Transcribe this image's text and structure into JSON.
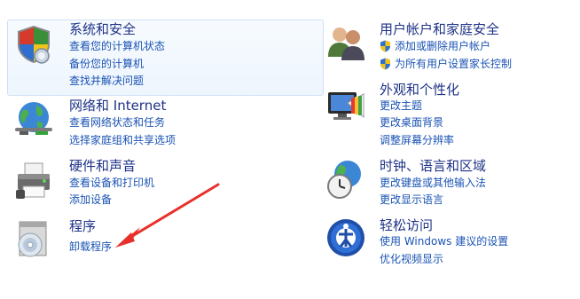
{
  "categories": [
    {
      "title": "系统和安全",
      "links": [
        "查看您的计算机状态",
        "备份您的计算机",
        "查找并解决问题"
      ]
    },
    {
      "title": "网络和 Internet",
      "links": [
        "查看网络状态和任务",
        "选择家庭组和共享选项"
      ]
    },
    {
      "title": "硬件和声音",
      "links": [
        "查看设备和打印机",
        "添加设备"
      ]
    },
    {
      "title": "程序",
      "links": [
        "卸载程序"
      ]
    },
    {
      "title": "用户帐户和家庭安全",
      "links": [
        "添加或删除用户帐户",
        "为所有用户设置家长控制"
      ]
    },
    {
      "title": "外观和个性化",
      "links": [
        "更改主题",
        "更改桌面背景",
        "调整屏幕分辨率"
      ]
    },
    {
      "title": "时钟、语言和区域",
      "links": [
        "更改键盘或其他输入法",
        "更改显示语言"
      ]
    },
    {
      "title": "轻松访问",
      "links": [
        "使用 Windows 建议的设置",
        "优化视频显示"
      ]
    }
  ],
  "colors": {
    "title": "#1e3287",
    "link": "#1a53b4",
    "arrow": "#e8302b",
    "highlight_border": "#cfe0f2"
  },
  "icons": {
    "system": "shield-security-icon",
    "network": "network-globe-icon",
    "hardware": "printer-icon",
    "programs": "programs-disc-icon",
    "users": "users-icon",
    "appearance": "monitor-palette-icon",
    "clock": "clock-globe-icon",
    "ease": "ease-of-access-icon",
    "uac": "uac-shield-icon"
  }
}
